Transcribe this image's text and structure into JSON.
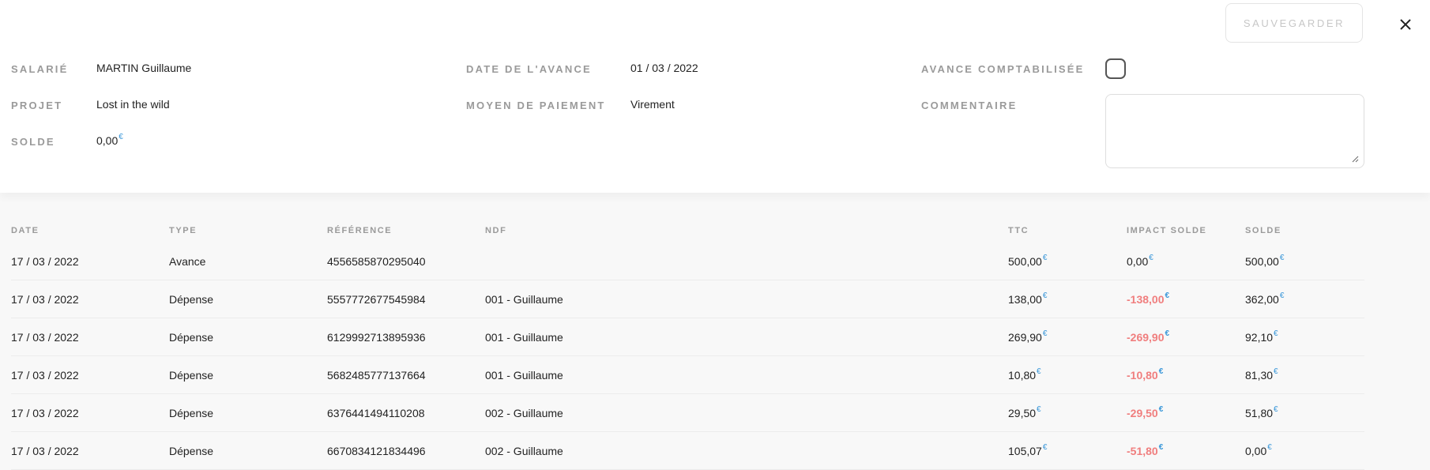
{
  "header": {
    "save_label": "SAUVEGARDER",
    "close_icon": "close-icon"
  },
  "fields": {
    "salarie": {
      "label": "SALARIÉ",
      "value": "MARTIN Guillaume"
    },
    "projet": {
      "label": "PROJET",
      "value": "Lost in the wild"
    },
    "solde": {
      "label": "SOLDE",
      "value": "0,00",
      "currency": "€"
    },
    "date_avance": {
      "label": "DATE DE L'AVANCE",
      "value": "01 / 03 / 2022"
    },
    "moyen_paiement": {
      "label": "MOYEN DE PAIEMENT",
      "value": "Virement"
    },
    "avance_comptabilisee": {
      "label": "AVANCE COMPTABILISÉE",
      "checked": false
    },
    "commentaire": {
      "label": "COMMENTAIRE",
      "value": ""
    }
  },
  "table": {
    "columns": {
      "date": "DATE",
      "type": "TYPE",
      "reference": "RÉFÉRENCE",
      "ndf": "NDF",
      "ttc": "TTC",
      "impact": "IMPACT SOLDE",
      "solde": "SOLDE"
    },
    "currency": "€",
    "rows": [
      {
        "date": "17 / 03 / 2022",
        "type": "Avance",
        "reference": "4556585870295040",
        "ndf": "",
        "ttc": "500,00",
        "impact": "0,00",
        "impact_negative": false,
        "solde": "500,00"
      },
      {
        "date": "17 / 03 / 2022",
        "type": "Dépense",
        "reference": "5557772677545984",
        "ndf": "001 - Guillaume",
        "ttc": "138,00",
        "impact": "-138,00",
        "impact_negative": true,
        "solde": "362,00"
      },
      {
        "date": "17 / 03 / 2022",
        "type": "Dépense",
        "reference": "6129992713895936",
        "ndf": "001 - Guillaume",
        "ttc": "269,90",
        "impact": "-269,90",
        "impact_negative": true,
        "solde": "92,10"
      },
      {
        "date": "17 / 03 / 2022",
        "type": "Dépense",
        "reference": "5682485777137664",
        "ndf": "001 - Guillaume",
        "ttc": "10,80",
        "impact": "-10,80",
        "impact_negative": true,
        "solde": "81,30"
      },
      {
        "date": "17 / 03 / 2022",
        "type": "Dépense",
        "reference": "6376441494110208",
        "ndf": "002 - Guillaume",
        "ttc": "29,50",
        "impact": "-29,50",
        "impact_negative": true,
        "solde": "51,80"
      },
      {
        "date": "17 / 03 / 2022",
        "type": "Dépense",
        "reference": "6670834121834496",
        "ndf": "002 - Guillaume",
        "ttc": "105,07",
        "impact": "-51,80",
        "impact_negative": true,
        "solde": "0,00"
      }
    ]
  },
  "colors": {
    "accent_currency": "#3a97d9",
    "negative": "#f07e7e",
    "label": "#9a9a9a"
  }
}
